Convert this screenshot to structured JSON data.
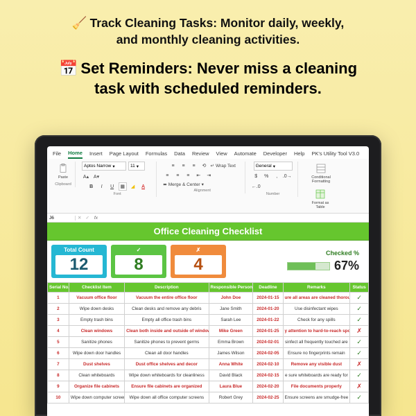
{
  "promo": {
    "line1_icon": "🧹",
    "line1a": "Track Cleaning Tasks: Monitor daily, weekly,",
    "line1b": "and monthly cleaning activities.",
    "line2_icon": "📅",
    "line2a": "Set Reminders: Never miss a cleaning",
    "line2b": "task with scheduled reminders."
  },
  "menu": {
    "file": "File",
    "home": "Home",
    "insert": "Insert",
    "pagelayout": "Page Layout",
    "formulas": "Formulas",
    "data": "Data",
    "review": "Review",
    "view": "View",
    "automate": "Automate",
    "developer": "Developer",
    "help": "Help",
    "pkutil": "PK's Utility Tool V3.0"
  },
  "ribbon": {
    "paste": "Paste",
    "clipboard": "Clipboard",
    "font_name": "Aptos Narrow",
    "font_size": "11",
    "font": "Font",
    "alignment": "Alignment",
    "wrap": "Wrap Text",
    "merge": "Merge & Center",
    "number_general": "General",
    "number": "Number",
    "condfmt": "Conditional Formatting",
    "fmttable": "Format as Table"
  },
  "fx": {
    "cell": "J6",
    "label": "fx"
  },
  "sheet_title": "Office Cleaning Checklist",
  "kpi": {
    "total_label": "Total Count",
    "total_value": "12",
    "checked_glyph": "✓",
    "checked_value": "8",
    "unchecked_glyph": "✗",
    "unchecked_value": "4",
    "pct_label": "Checked %",
    "pct_value": "67%",
    "pct_fill": 67
  },
  "cols": {
    "serial": "Serial No.",
    "item": "Checklist Item",
    "desc": "Description",
    "resp": "Responsible Person",
    "deadline": "Deadline",
    "remarks": "Remarks",
    "status": "Status"
  },
  "rows": [
    {
      "n": "1",
      "item": "Vacuum office floor",
      "desc": "Vacuum the entire office floor",
      "resp": "John Doe",
      "date": "2024-01-15",
      "rem": "ure all areas are cleaned thoroug",
      "ok": true,
      "hi": true
    },
    {
      "n": "2",
      "item": "Wipe down desks",
      "desc": "Clean desks and remove any debris",
      "resp": "Jane Smith",
      "date": "2024-01-20",
      "rem": "Use disinfectant wipes",
      "ok": true,
      "hi": false
    },
    {
      "n": "3",
      "item": "Empty trash bins",
      "desc": "Empty all office trash bins",
      "resp": "Sarah Lee",
      "date": "2024-01-22",
      "rem": "Check for any spills",
      "ok": true,
      "hi": false
    },
    {
      "n": "4",
      "item": "Clean windows",
      "desc": "Clean both inside and outside of windows",
      "resp": "Mike Green",
      "date": "2024-01-25",
      "rem": "y attention to hard-to-reach spo",
      "ok": false,
      "hi": true
    },
    {
      "n": "5",
      "item": "Sanitize phones",
      "desc": "Sanitize phones to prevent germs",
      "resp": "Emma Brown",
      "date": "2024-02-01",
      "rem": "sinfect all frequently touched are",
      "ok": true,
      "hi": false
    },
    {
      "n": "6",
      "item": "Wipe down door handles",
      "desc": "Clean all door handles",
      "resp": "James Wilson",
      "date": "2024-02-05",
      "rem": "Ensure no fingerprints remain",
      "ok": true,
      "hi": false
    },
    {
      "n": "7",
      "item": "Dust shelves",
      "desc": "Dust office shelves and decor",
      "resp": "Anna White",
      "date": "2024-02-10",
      "rem": "Remove any visible dust",
      "ok": false,
      "hi": true
    },
    {
      "n": "8",
      "item": "Clean whiteboards",
      "desc": "Wipe down whiteboards for cleanliness",
      "resp": "David Black",
      "date": "2024-02-15",
      "rem": "e sure whiteboards are ready for",
      "ok": true,
      "hi": false
    },
    {
      "n": "9",
      "item": "Organize file cabinets",
      "desc": "Ensure file cabinets are organized",
      "resp": "Laura Blue",
      "date": "2024-02-20",
      "rem": "File documents properly",
      "ok": false,
      "hi": true
    },
    {
      "n": "10",
      "item": "Wipe down computer screens",
      "desc": "Wipe down all office computer screens",
      "resp": "Robert Grey",
      "date": "2024-02-25",
      "rem": "Ensure screens are smudge-free",
      "ok": true,
      "hi": false
    }
  ]
}
